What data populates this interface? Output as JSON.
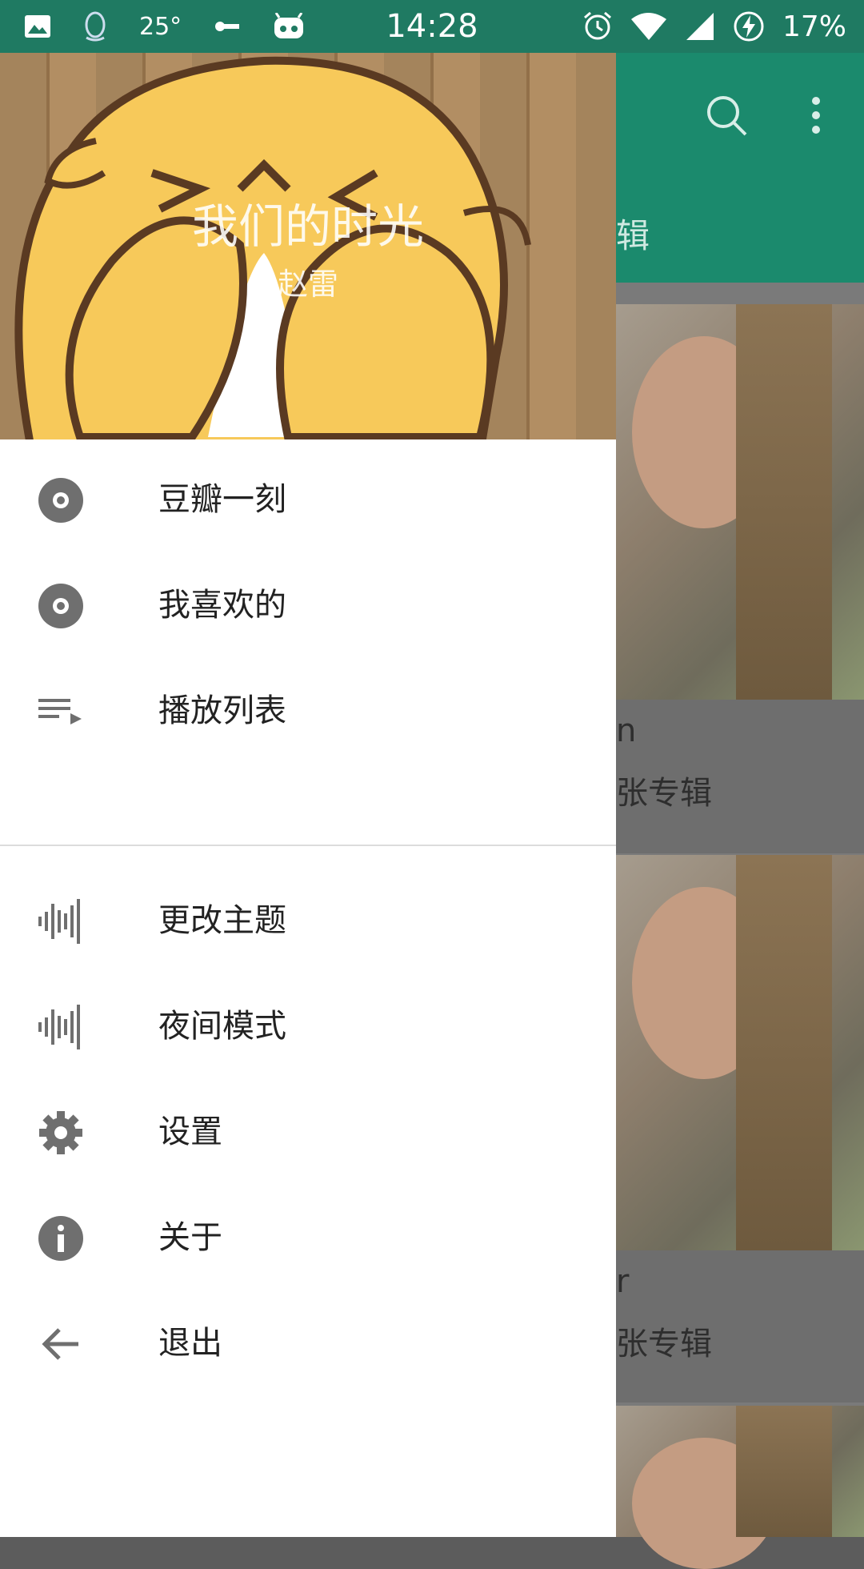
{
  "status_bar": {
    "temperature": "25°",
    "time": "14:28",
    "battery": "17%"
  },
  "drawer": {
    "header": {
      "title": "我们的时光",
      "subtitle": "赵雷"
    },
    "primary_items": [
      {
        "label": "豆瓣一刻",
        "icon": "disc-icon"
      },
      {
        "label": "我喜欢的",
        "icon": "disc-icon"
      },
      {
        "label": "播放列表",
        "icon": "playlist-icon"
      }
    ],
    "secondary_items": [
      {
        "label": "更改主题",
        "icon": "waveform-icon"
      },
      {
        "label": "夜间模式",
        "icon": "waveform-icon"
      },
      {
        "label": "设置",
        "icon": "gear-icon"
      },
      {
        "label": "关于",
        "icon": "info-icon"
      },
      {
        "label": "退出",
        "icon": "back-arrow-icon"
      }
    ]
  },
  "background_app": {
    "tab_partial": "辑",
    "cards": [
      {
        "line1": "n",
        "line2": "张专辑"
      },
      {
        "line1": "r",
        "line2": "张专辑"
      }
    ]
  },
  "colors": {
    "status_bar": "#1f7a62",
    "toolbar": "#1b8a6d",
    "icon_grey": "#6f6f6f"
  }
}
